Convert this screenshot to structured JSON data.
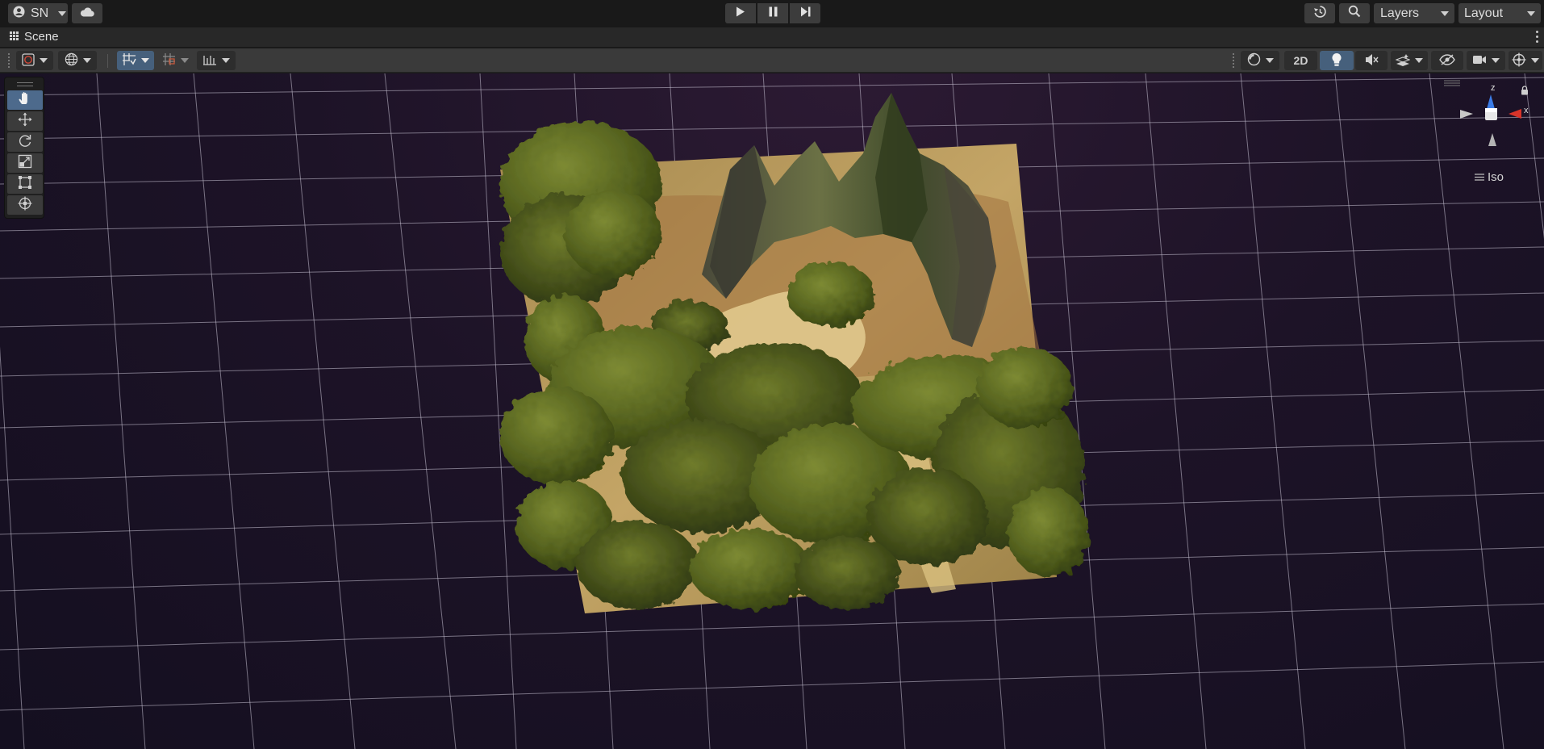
{
  "topbar": {
    "account_label": "SN",
    "account_icon": "account-circle-icon",
    "cloud_icon": "cloud-icon",
    "play_icon": "play-icon",
    "pause_icon": "pause-icon",
    "step_icon": "step-icon",
    "history_icon": "history-icon",
    "search_icon": "search-icon",
    "layers_label": "Layers",
    "layout_label": "Layout"
  },
  "scene_tab": {
    "label": "Scene",
    "icon": "grid-tab-icon"
  },
  "toolbar": {
    "left_tools": [
      "tool-handle-icon",
      "global-pivot-icon",
      "grid-snap-icon",
      "snap-increment-icon",
      "ruler-icon"
    ],
    "mode_2d_label": "2D",
    "right_tools": [
      "draw-mode-icon",
      "lighting-icon",
      "audio-icon",
      "effects-icon",
      "visibility-icon",
      "camera-icon",
      "gizmos-icon"
    ]
  },
  "palette": {
    "tools": [
      "hand-tool",
      "move-tool",
      "rotate-tool",
      "scale-tool",
      "rect-tool",
      "transform-tool"
    ],
    "active_tool": "hand-tool"
  },
  "gizmo": {
    "z_label": "z",
    "x_label": "x",
    "projection_label": "Iso"
  },
  "colors": {
    "active_blue": "#46607c",
    "axis_x": "#d8342a",
    "axis_z": "#3c7ce6",
    "grass": "#5d6b25",
    "sand": "#c9ad72"
  }
}
